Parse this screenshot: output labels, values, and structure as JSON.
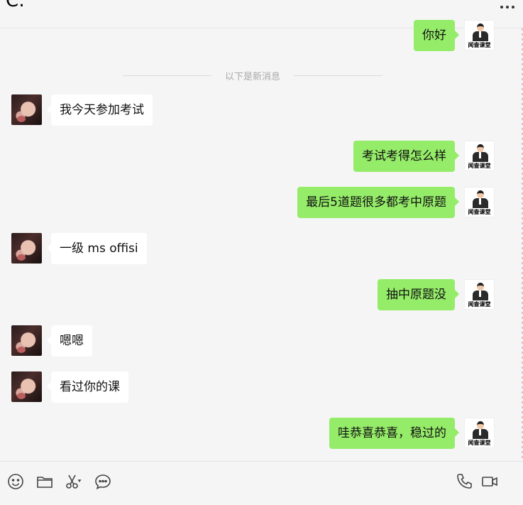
{
  "header": {
    "title": "C:",
    "more_icon": "more-icon"
  },
  "divider": {
    "text": "以下是新消息"
  },
  "avatars": {
    "contact": "contact-avatar",
    "self": "self-avatar",
    "self_brand": "闻啬课堂"
  },
  "colors": {
    "bubble_self": "#95ec69",
    "bubble_contact": "#ffffff",
    "background": "#f5f5f5"
  },
  "messages": [
    {
      "from": "self",
      "text": "你好"
    },
    {
      "from": "contact",
      "text": "我今天参加考试"
    },
    {
      "from": "self",
      "text": "考试考得怎么样"
    },
    {
      "from": "self",
      "text": "最后5道题很多都考中原题"
    },
    {
      "from": "contact",
      "text": "一级 ms offisi"
    },
    {
      "from": "self",
      "text": "抽中原题没"
    },
    {
      "from": "contact",
      "text": "嗯嗯"
    },
    {
      "from": "contact",
      "text": "看过你的课"
    },
    {
      "from": "self",
      "text": "哇恭喜恭喜，稳过的"
    }
  ],
  "toolbar": {
    "left": [
      "emoji-icon",
      "folder-icon",
      "scissors-icon",
      "chat-bubble-icon"
    ],
    "right": [
      "phone-icon",
      "video-icon"
    ]
  }
}
